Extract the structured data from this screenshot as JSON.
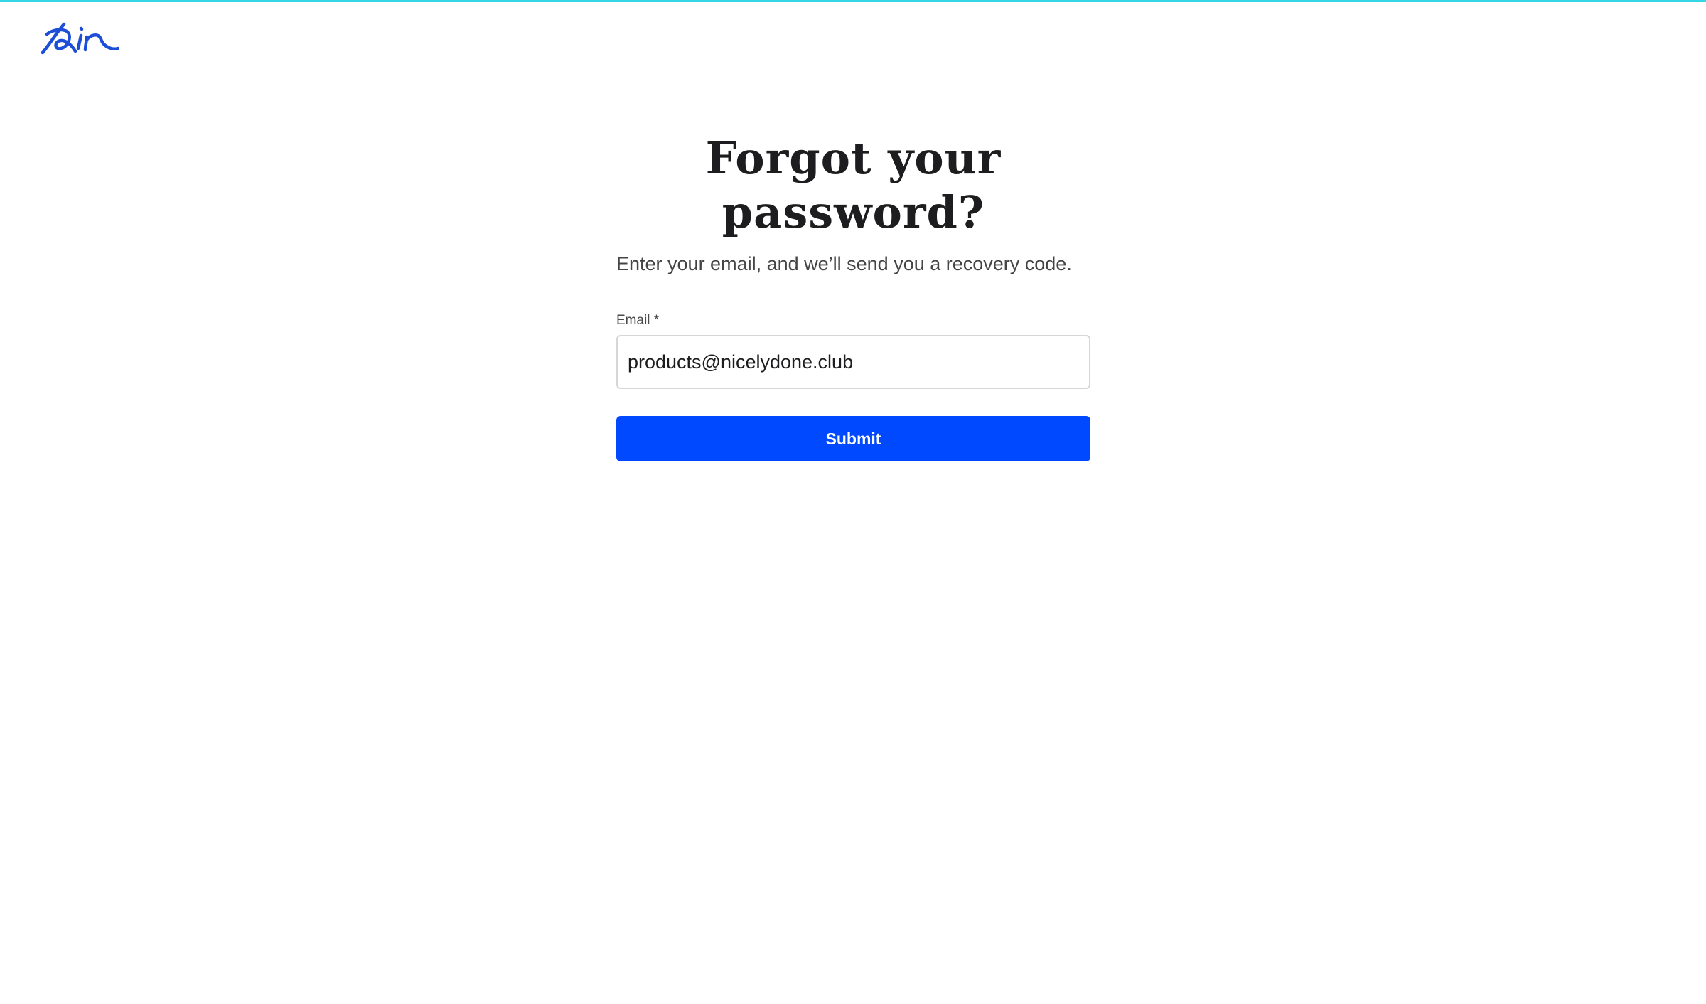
{
  "colors": {
    "top_bar": "#35d7e6",
    "brand": "#0049ff",
    "logo": "#1d4ed8",
    "title": "#1d1d1f",
    "subtitle": "#444444"
  },
  "logo": {
    "text": "Air",
    "icon": "air-logo-icon"
  },
  "form": {
    "title": "Forgot your password?",
    "subtitle": "Enter your email, and we’ll send you a recovery code.",
    "email_label": "Email *",
    "email_value": "products@nicelydone.club",
    "submit_label": "Submit"
  }
}
